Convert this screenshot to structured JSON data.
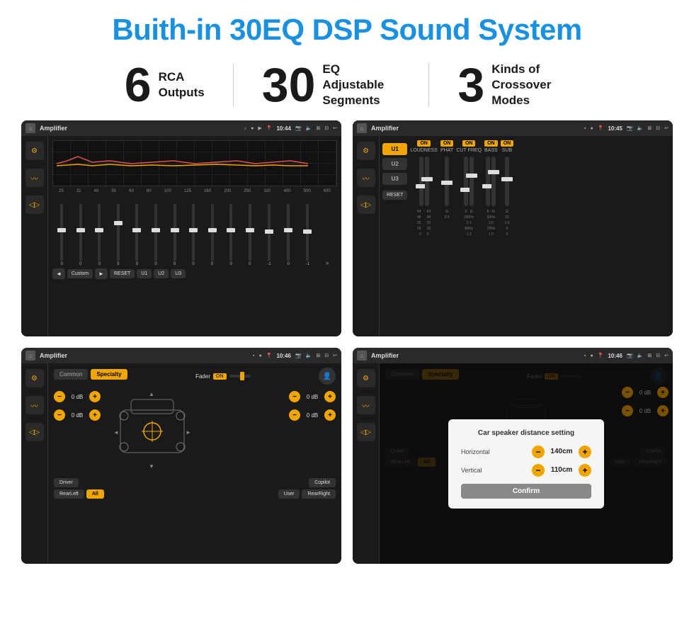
{
  "title": "Buith-in 30EQ DSP Sound System",
  "stats": [
    {
      "number": "6",
      "label": "RCA\nOutputs"
    },
    {
      "number": "30",
      "label": "EQ Adjustable\nSegments"
    },
    {
      "number": "3",
      "label": "Kinds of\nCrossover Modes"
    }
  ],
  "screens": {
    "eq": {
      "title": "Amplifier",
      "time": "10:44",
      "eq_labels": [
        "25",
        "32",
        "40",
        "50",
        "63",
        "80",
        "100",
        "125",
        "160",
        "200",
        "250",
        "320",
        "400",
        "500",
        "630"
      ],
      "eq_values": [
        "0",
        "0",
        "0",
        "5",
        "0",
        "0",
        "0",
        "0",
        "0",
        "0",
        "0",
        "-1",
        "0",
        "-1"
      ],
      "preset": "Custom",
      "buttons": [
        "RESET",
        "U1",
        "U2",
        "U3"
      ]
    },
    "crossover": {
      "title": "Amplifier",
      "time": "10:45",
      "channels": [
        "U1",
        "U2",
        "U3"
      ],
      "controls": [
        "LOUDNESS",
        "PHAT",
        "CUT FREQ",
        "BASS",
        "SUB"
      ],
      "reset_label": "RESET"
    },
    "fader": {
      "title": "Amplifier",
      "time": "10:46",
      "modes": [
        "Common",
        "Specialty"
      ],
      "fader_label": "Fader",
      "fader_on": "ON",
      "db_values": [
        "0 dB",
        "0 dB",
        "0 dB",
        "0 dB"
      ],
      "bottom_btns": [
        "Driver",
        "RearLeft",
        "All",
        "User",
        "RearRight",
        "Copilot"
      ]
    },
    "distance": {
      "title": "Amplifier",
      "time": "10:46",
      "modes": [
        "Common",
        "Specialty"
      ],
      "dialog_title": "Car speaker distance setting",
      "horizontal_label": "Horizontal",
      "horizontal_value": "140cm",
      "vertical_label": "Vertical",
      "vertical_value": "110cm",
      "confirm_label": "Confirm",
      "db_values": [
        "0 dB",
        "0 dB"
      ],
      "bottom_btns": [
        "Driver",
        "RearLeft",
        "All",
        "User",
        "RearRight",
        "Copilot"
      ]
    }
  }
}
